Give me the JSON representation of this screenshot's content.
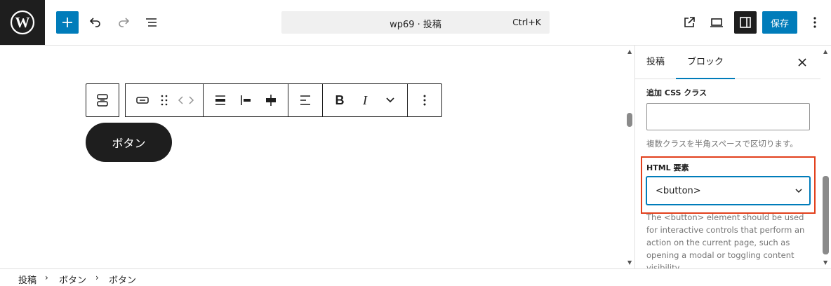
{
  "header": {
    "site_title": "wp69 · 投稿",
    "shortcut": "Ctrl+K",
    "save_label": "保存"
  },
  "icons": {
    "logo": "wordpress-logo-icon",
    "add": "plus-icon",
    "undo": "undo-icon",
    "redo": "redo-icon",
    "list_view": "list-view-icon",
    "view_page": "external-link-icon",
    "preview": "laptop-preview-icon",
    "settings": "sidebar-toggle-icon",
    "more": "vertical-dots-icon"
  },
  "canvas": {
    "button_text": "ボタン"
  },
  "sidebar": {
    "tabs": [
      {
        "label": "投稿"
      },
      {
        "label": "ブロック"
      }
    ],
    "css_class_label": "追加 CSS クラス",
    "css_class_value": "",
    "css_class_help": "複数クラスを半角スペースで区切ります。",
    "html_element_label": "HTML 要素",
    "html_element_value": "<button>",
    "html_element_help": "The <button> element should be used for interactive controls that perform an action on the current page, such as opening a modal or toggling content visibility."
  },
  "breadcrumb": [
    {
      "label": "投稿"
    },
    {
      "label": "ボタン"
    },
    {
      "label": "ボタン"
    }
  ],
  "colors": {
    "accent": "#007cba",
    "dark": "#1e1e1e",
    "highlight": "#e2401c"
  }
}
